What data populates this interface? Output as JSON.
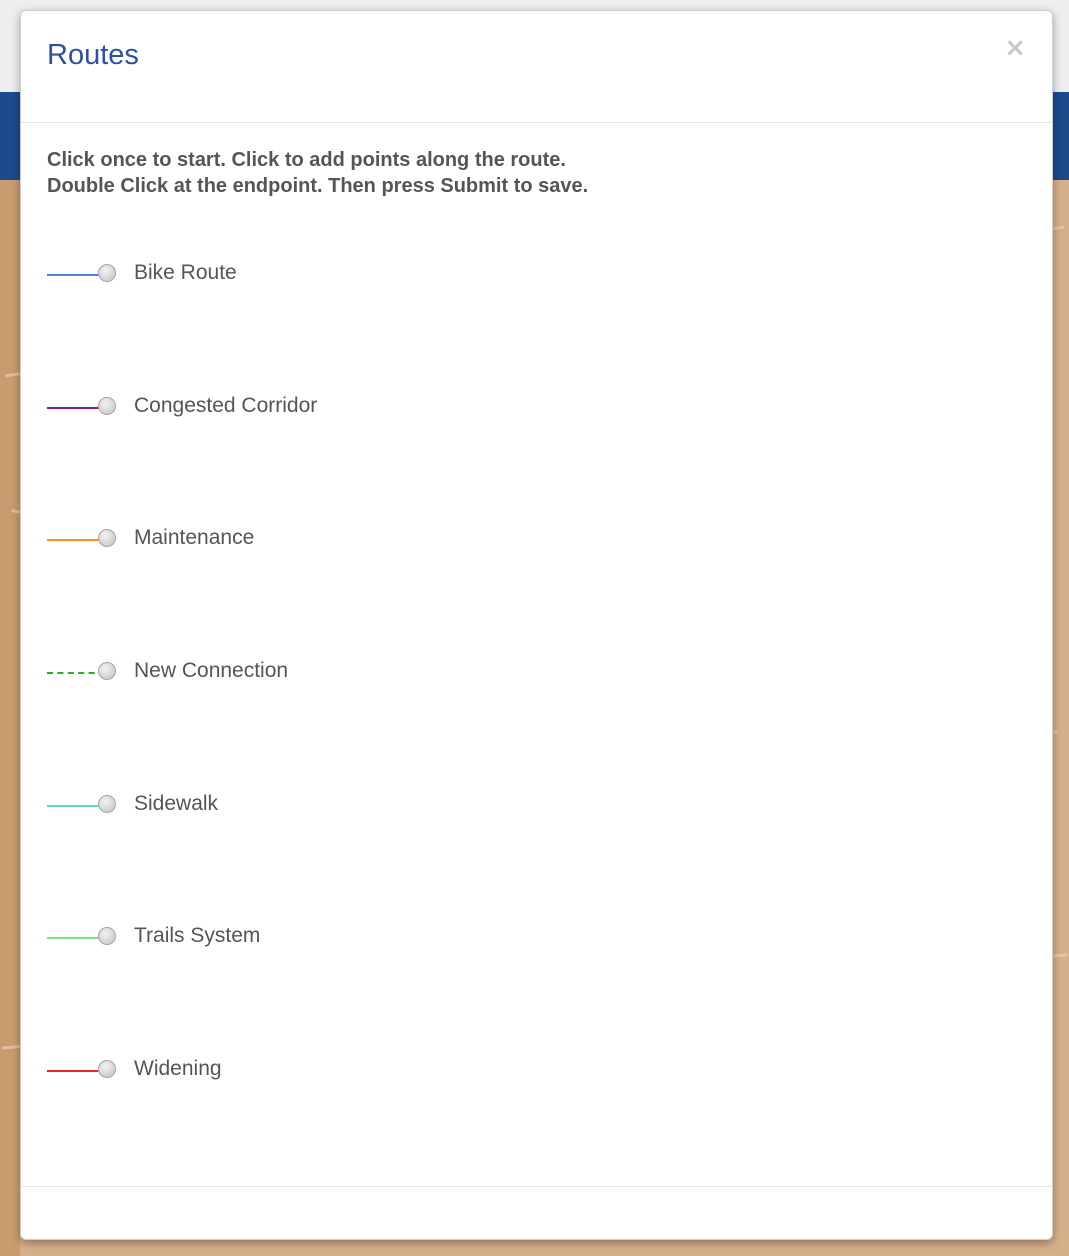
{
  "dialog": {
    "title": "Routes",
    "close_symbol": "×",
    "instructions": [
      "Click once to start. Click to add points along the route.",
      "Double Click at the endpoint. Then press Submit to save."
    ]
  },
  "routes": [
    {
      "label": "Bike Route",
      "color": "#4a86d4",
      "line_style": "solid"
    },
    {
      "label": "Congested Corridor",
      "color": "#8a1a8a",
      "line_style": "solid"
    },
    {
      "label": "Maintenance",
      "color": "#ff8c1a",
      "line_style": "solid"
    },
    {
      "label": "New Connection",
      "color": "#1fb31f",
      "line_style": "dashed"
    },
    {
      "label": "Sidewalk",
      "color": "#66d1d1",
      "line_style": "solid"
    },
    {
      "label": "Trails System",
      "color": "#7ae87a",
      "line_style": "solid"
    },
    {
      "label": "Widening",
      "color": "#ee2222",
      "line_style": "solid"
    }
  ],
  "colors": {
    "title": "#2f4fa3",
    "text": "#555555",
    "navbar": "#1c4a8c",
    "map_background": "#d6b08a"
  }
}
